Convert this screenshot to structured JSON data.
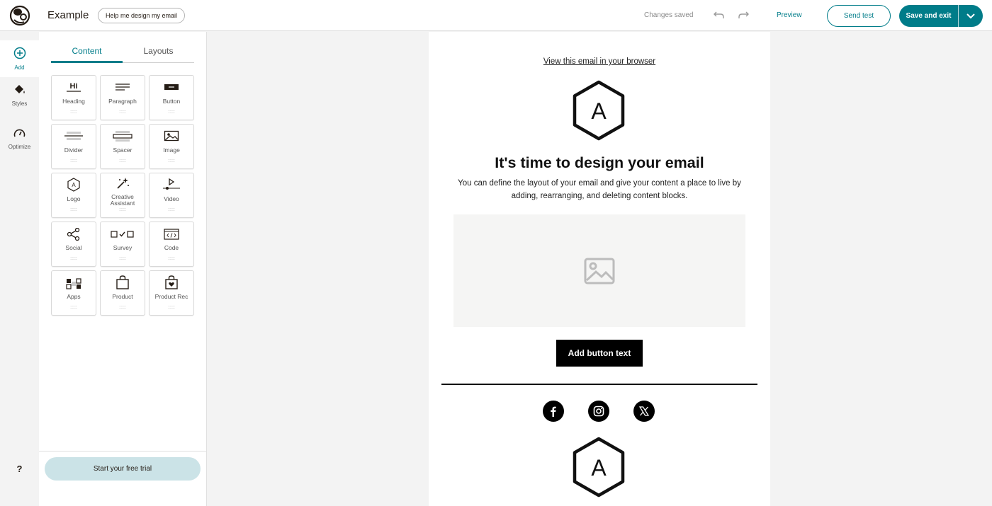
{
  "app": {
    "title": "Example",
    "help_button": "Help me design my email"
  },
  "toolbar": {
    "status": "Changes saved",
    "preview": "Preview",
    "send_test": "Send test",
    "save_exit": "Save and exit"
  },
  "rail": {
    "add": "Add",
    "styles": "Styles",
    "optimize": "Optimize",
    "help": "?"
  },
  "panel": {
    "tabs": [
      "Content",
      "Layouts"
    ],
    "blocks": [
      {
        "label": "Heading",
        "icon": "heading-icon"
      },
      {
        "label": "Paragraph",
        "icon": "paragraph-icon"
      },
      {
        "label": "Button",
        "icon": "button-icon"
      },
      {
        "label": "Divider",
        "icon": "divider-icon"
      },
      {
        "label": "Spacer",
        "icon": "spacer-icon"
      },
      {
        "label": "Image",
        "icon": "image-icon"
      },
      {
        "label": "Logo",
        "icon": "logo-icon"
      },
      {
        "label": "Creative Assistant",
        "icon": "magic-wand-icon"
      },
      {
        "label": "Video",
        "icon": "video-icon"
      },
      {
        "label": "Social",
        "icon": "share-icon"
      },
      {
        "label": "Survey",
        "icon": "survey-icon"
      },
      {
        "label": "Code",
        "icon": "code-icon"
      },
      {
        "label": "Apps",
        "icon": "apps-icon"
      },
      {
        "label": "Product",
        "icon": "shopping-bag-icon"
      },
      {
        "label": "Product Rec",
        "icon": "product-rec-icon"
      }
    ],
    "heading_icon_text": "Hi",
    "grip": ":::::",
    "trial_button": "Start your free trial"
  },
  "email": {
    "view_link": "View this email in your browser",
    "logo_letter": "A",
    "headline": "It's time to design your email",
    "body": "You can define the layout of your email and give your content a place to live by adding, rearranging, and deleting content blocks.",
    "button": "Add button text"
  },
  "colors": {
    "brand": "#007c89",
    "trial_bg": "#cbe3e7",
    "canvas_bg": "#f3f3f3"
  }
}
